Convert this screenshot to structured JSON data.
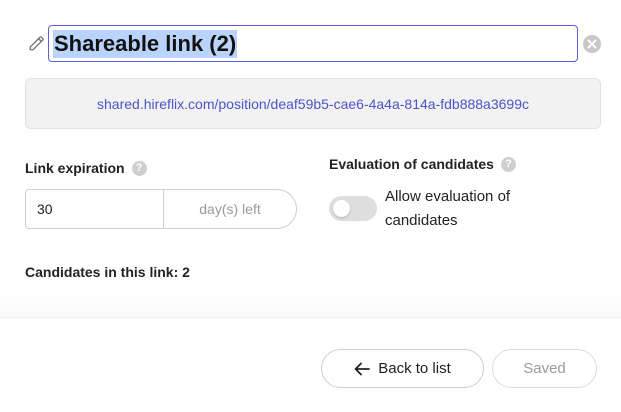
{
  "title": {
    "value": "Shareable link (2)"
  },
  "share": {
    "url": "shared.hireflix.com/position/deaf59b5-cae6-4a4a-814a-fdb888a3699c"
  },
  "expiration": {
    "label": "Link expiration",
    "value": "30",
    "suffix": "day(s) left"
  },
  "evaluation": {
    "label": "Evaluation of candidates",
    "toggle_label": "Allow evaluation of candidates",
    "enabled": false
  },
  "candidates": {
    "count_text": "Candidates in this link: 2"
  },
  "help_glyph": "?",
  "actions": {
    "back_label": "Back to list",
    "saved_label": "Saved"
  },
  "icons": [
    "pencil-icon",
    "clear-icon",
    "help-icon",
    "arrow-left-icon"
  ],
  "colors": {
    "accent": "#5b5fd6",
    "link": "#4b55c9",
    "selection": "#b9d3fb",
    "muted": "#9a9a9a"
  }
}
